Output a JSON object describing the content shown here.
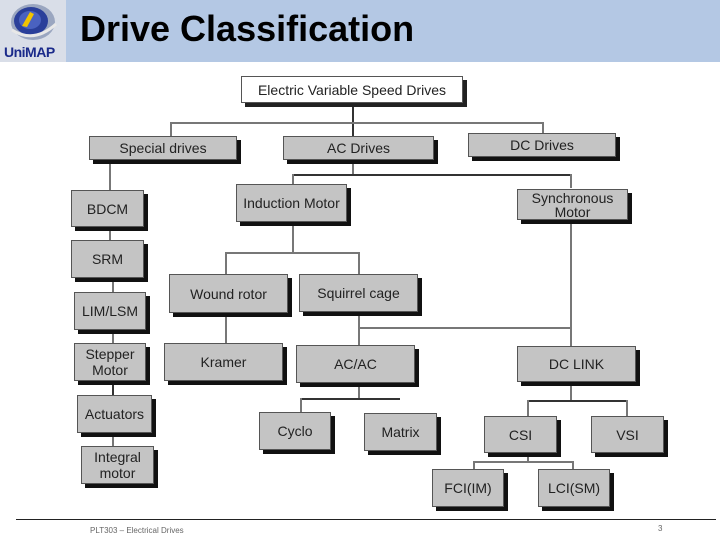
{
  "header": {
    "title": "Drive Classification",
    "logo_text": "UniMAP",
    "logo_icon": "university-logo-icon"
  },
  "diagram": {
    "root": "Electric Variable Speed Drives",
    "level1": [
      "Special drives",
      "AC Drives",
      "DC Drives"
    ],
    "special_drives": [
      "BDCM",
      "SRM",
      "LIM/LSM",
      "Stepper Motor",
      "Actuators",
      "Integral motor"
    ],
    "ac_drives": [
      "Induction Motor",
      "Synchronous Motor"
    ],
    "induction_motor": [
      "Wound rotor",
      "Squirrel cage"
    ],
    "wound_rotor": [
      "Kramer"
    ],
    "squirrel_cage": [
      "AC/AC",
      "DC LINK"
    ],
    "ac_ac": [
      "Cyclo",
      "Matrix"
    ],
    "dc_link": [
      "CSI",
      "VSI"
    ],
    "csi": [
      "FCI(IM)",
      "LCI(SM)"
    ]
  },
  "footer": {
    "course": "PLT303 – Electrical Drives",
    "page": "3"
  }
}
